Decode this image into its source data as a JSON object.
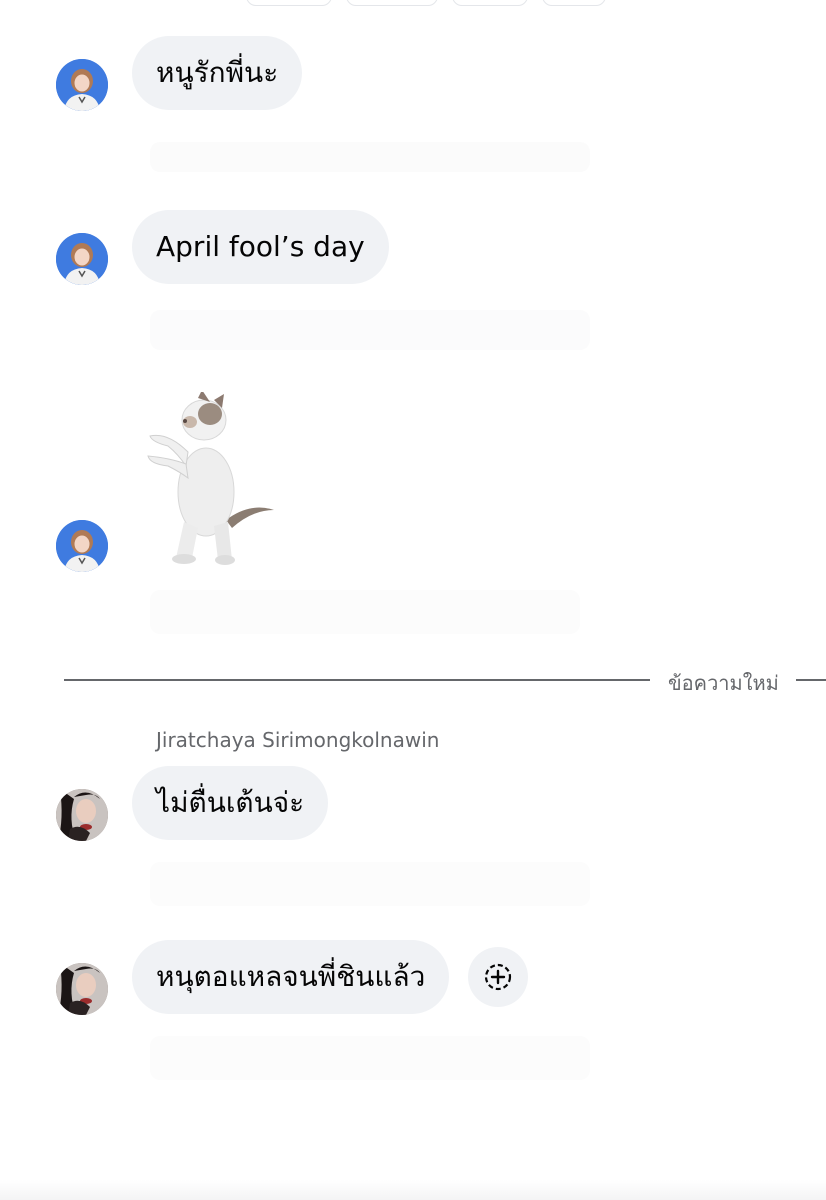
{
  "messages": [
    {
      "text": "หนูรักพี่นะ"
    },
    {
      "text": "April fool’s day"
    },
    {
      "sticker": "dancing-kitten-sticker"
    },
    {
      "text": "ไม่ตื่นเต้นจ่ะ"
    },
    {
      "text": "หนุตอแหลจนพี่ชินแล้ว"
    }
  ],
  "divider": {
    "label": "ข้อความใหม่"
  },
  "sender": {
    "name": "Jiratchaya Sirimongkolnawin"
  },
  "react_button": {
    "icon": "add-reaction-icon"
  },
  "colors": {
    "bubble": "#f0f2f5",
    "secondary_text": "#65676b",
    "avatar_blue": "#3f7be0"
  }
}
